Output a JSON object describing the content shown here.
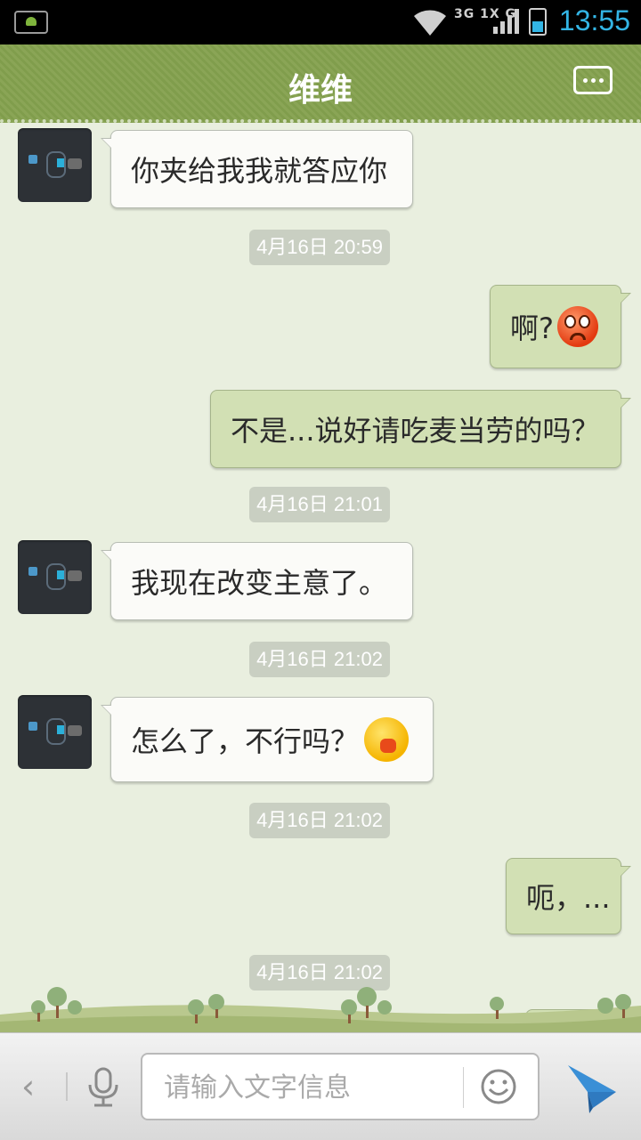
{
  "status_bar": {
    "network_label": "3G 1X G",
    "time": "13:55"
  },
  "header": {
    "title": "维维"
  },
  "messages": [
    {
      "side": "left",
      "text": "你夹给我我就答应你"
    },
    {
      "timestamp": "4月16日 20:59"
    },
    {
      "side": "right",
      "text": "啊?",
      "emoji": "angry-face-emoji"
    },
    {
      "side": "right",
      "text": "不是...说好请吃麦当劳的吗？"
    },
    {
      "timestamp": "4月16日 21:01"
    },
    {
      "side": "left",
      "text": "我现在改变主意了。"
    },
    {
      "timestamp": "4月16日 21:02"
    },
    {
      "side": "left",
      "text": "怎么了，不行吗？",
      "emoji": "shy-face-emoji"
    },
    {
      "timestamp": "4月16日 21:02"
    },
    {
      "side": "right",
      "text": "呃，..."
    },
    {
      "timestamp": "4月16日 21:02"
    }
  ],
  "input": {
    "placeholder": "请输入文字信息"
  },
  "colors": {
    "header": "#8aa556",
    "background": "#e9efdf",
    "bubble_right": "#d2e0b4",
    "bubble_left": "#fbfbf8",
    "send_icon": "#3a8fd6"
  }
}
